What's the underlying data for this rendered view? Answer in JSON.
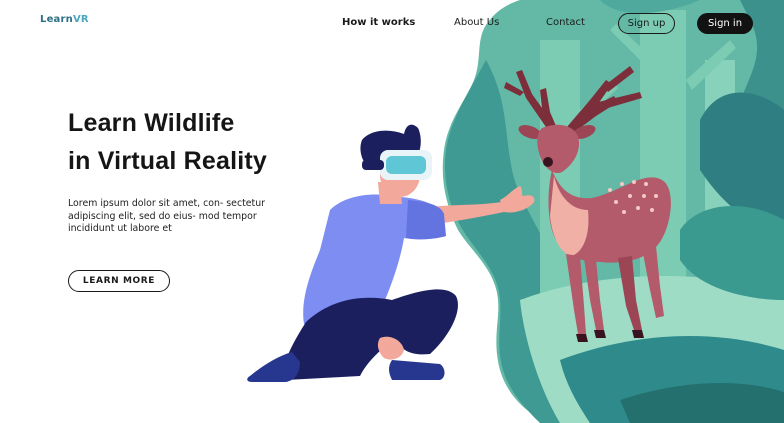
{
  "brand": {
    "name_part1": "Learn",
    "name_part2": "VR"
  },
  "nav": {
    "how_it_works": "How it works",
    "about_us": "About Us",
    "contact": "Contact",
    "sign_up": "Sign up",
    "sign_in": "Sign in"
  },
  "hero": {
    "title_line1": "Learn Wildlife",
    "title_line2": "in Virtual Reality",
    "description": "Lorem ipsum dolor sit amet, con- sectetur adipiscing elit, sed do eius- mod tempor incididunt ut labore et",
    "cta_label": "LEARN MORE"
  },
  "colors": {
    "forest_dark": "#2e8a8f",
    "forest_mid": "#55b3a2",
    "forest_light": "#8fd0b8",
    "deer": "#b35b6a",
    "person_shirt": "#7d8df2",
    "person_pants": "#1b1f5e"
  },
  "icons": {
    "logo": "learnvr-logo",
    "headset": "vr-headset-icon"
  }
}
